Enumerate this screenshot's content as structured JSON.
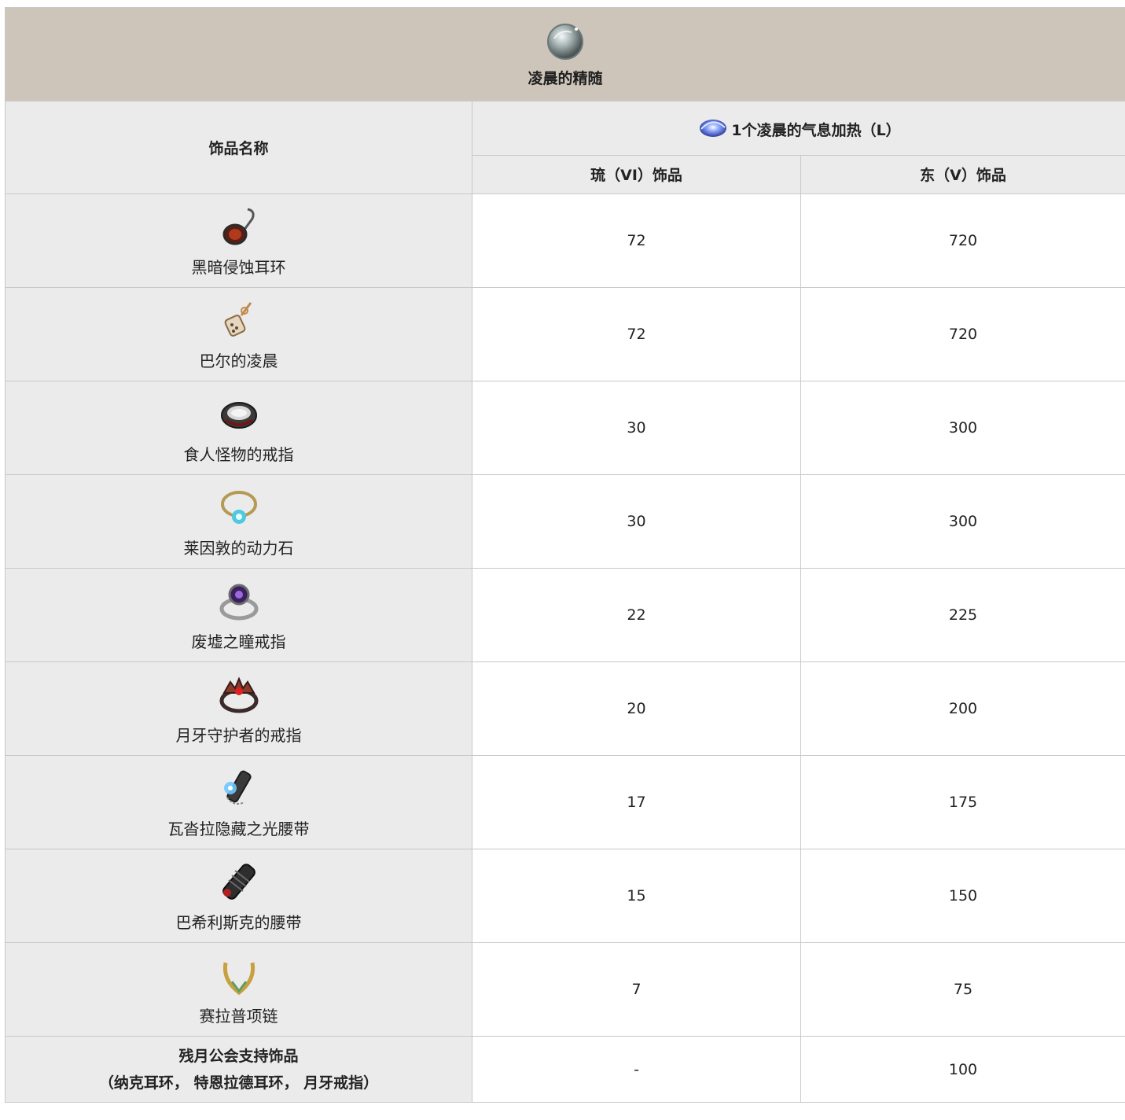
{
  "title": "凌晨的精随",
  "header": {
    "name_col": "饰品名称",
    "group_label": "1个凌晨的气息加热（L）",
    "col_vi": "琉（VI）饰品",
    "col_v": "东（V）饰品"
  },
  "rows": [
    {
      "name": "黑暗侵蚀耳环",
      "icon": "dark-earring-icon",
      "vi": "72",
      "v": "720"
    },
    {
      "name": "巴尔的凌晨",
      "icon": "bal-dawn-earring-icon",
      "vi": "72",
      "v": "720"
    },
    {
      "name": "食人怪物的戒指",
      "icon": "ogre-ring-icon",
      "vi": "30",
      "v": "300"
    },
    {
      "name": "莱因敦的动力石",
      "icon": "power-stone-icon",
      "vi": "30",
      "v": "300"
    },
    {
      "name": "废墟之瞳戒指",
      "icon": "ruin-eye-ring-icon",
      "vi": "22",
      "v": "225"
    },
    {
      "name": "月牙守护者的戒指",
      "icon": "crescent-guardian-ring-icon",
      "vi": "20",
      "v": "200"
    },
    {
      "name": "瓦沓拉隐藏之光腰带",
      "icon": "hidden-light-belt-icon",
      "vi": "17",
      "v": "175"
    },
    {
      "name": "巴希利斯克的腰带",
      "icon": "basilisk-belt-icon",
      "vi": "15",
      "v": "150"
    },
    {
      "name": "赛拉普项链",
      "icon": "serap-necklace-icon",
      "vi": "7",
      "v": "75"
    }
  ],
  "last_row": {
    "name_line1": "残月公会支持饰品",
    "name_line2": "（纳克耳环， 特恩拉德耳环， 月牙戒指）",
    "vi": "-",
    "v": "100"
  }
}
